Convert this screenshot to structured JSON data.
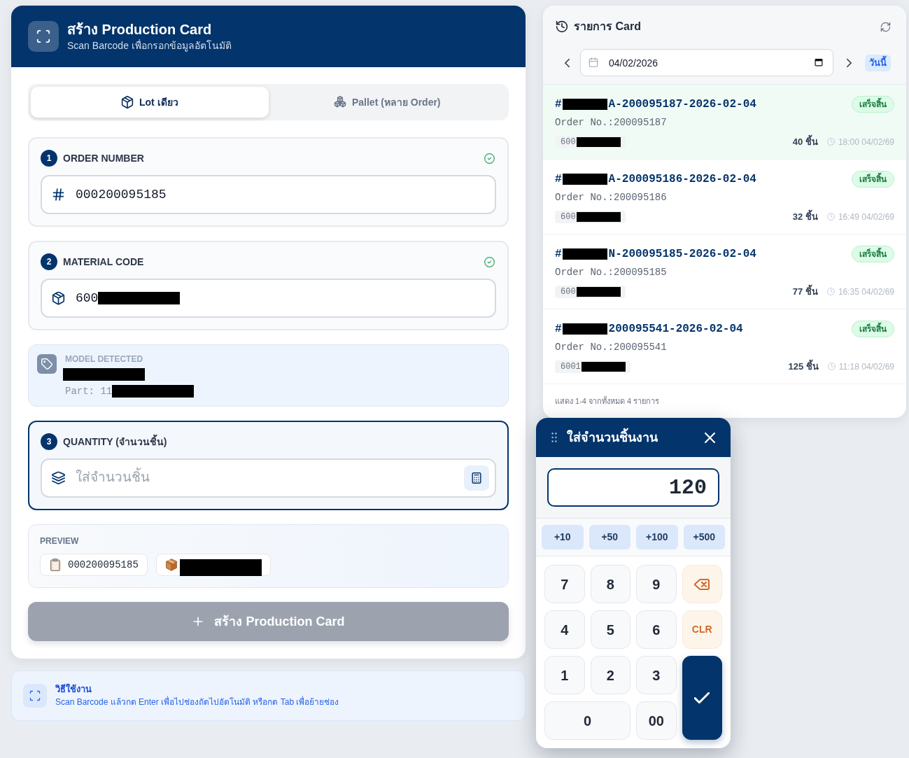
{
  "form_card": {
    "header": {
      "title": "สร้าง Production Card",
      "subtitle": "Scan Barcode เพื่อกรอกข้อมูลอัตโนมัติ"
    },
    "tabs": [
      {
        "kind": "lot",
        "label": "Lot เดียว",
        "selected": true
      },
      {
        "kind": "pallet",
        "label": "Pallet (หลาย Order)",
        "selected": false
      }
    ],
    "order_step": {
      "number": "1",
      "label": "ORDER NUMBER",
      "done": true,
      "active": false,
      "field": {
        "kind": "order",
        "value": "000200095185"
      }
    },
    "material_step": {
      "number": "2",
      "label": "MATERIAL CODE",
      "done": true,
      "active": false,
      "field": {
        "kind": "material",
        "value": "600",
        "redacted": true
      }
    },
    "model_detected": {
      "label": "MODEL DETECTED",
      "name_redacted": true,
      "part": "Part: 11",
      "part_redacted": true
    },
    "quantity_step": {
      "number": "3",
      "label": "QUANTITY (จำนวนชิ้น)",
      "done": false,
      "active": true,
      "field": {
        "kind": "quantity",
        "placeholder": "ใส่จำนวนชิ้น"
      }
    },
    "preview": {
      "label": "PREVIEW",
      "chips": [
        {
          "kind": "order",
          "value": "000200095185"
        },
        {
          "kind": "material",
          "redacted": true
        }
      ]
    },
    "submit_button": {
      "label": "สร้าง Production Card",
      "disabled": true
    }
  },
  "help": {
    "title": "วิธีใช้งาน",
    "text": "Scan Barcode แล้วกด Enter เพื่อไปช่องถัดไปอัตโนมัติ หรือกด Tab เพื่อย้ายช่อง"
  },
  "list_panel": {
    "title": "รายการ Card",
    "date": "04/02/2026",
    "today_button": "วันนี้",
    "items": [
      {
        "title_prefix": "#",
        "title_redacted": true,
        "title": "A-200095187-2026-02-04",
        "status": "เสร็จสิ้น",
        "order_no": "Order No.:200095187",
        "material": "600",
        "material_redacted": true,
        "quantity": "40 ชิ้น",
        "time": "18:00 04/02/69",
        "selected": true
      },
      {
        "title_prefix": "#",
        "title_redacted": true,
        "title": "A-200095186-2026-02-04",
        "status": "เสร็จสิ้น",
        "order_no": "Order No.:200095186",
        "material": "600",
        "material_redacted": true,
        "quantity": "32 ชิ้น",
        "time": "16:49 04/02/69",
        "selected": false
      },
      {
        "title_prefix": "#",
        "title_redacted": true,
        "title": "N-200095185-2026-02-04",
        "status": "เสร็จสิ้น",
        "order_no": "Order No.:200095185",
        "material": "600",
        "material_redacted": true,
        "quantity": "77 ชิ้น",
        "time": "16:35 04/02/69",
        "selected": false
      },
      {
        "title_prefix": "#",
        "title_redacted": true,
        "title": "200095541-2026-02-04",
        "status": "เสร็จสิ้น",
        "order_no": "Order No.:200095541",
        "material": "6001",
        "material_redacted": true,
        "quantity": "125 ชิ้น",
        "time": "11:18 04/02/69",
        "selected": false
      }
    ],
    "footer": "แสดง 1-4 จากทั้งหมด 4 รายการ"
  },
  "keypad": {
    "title": "ใส่จำนวนชิ้นงาน",
    "value": "120",
    "quick_add": [
      "+10",
      "+50",
      "+100",
      "+500"
    ],
    "keys": [
      {
        "kind": "digit",
        "label": "7"
      },
      {
        "kind": "digit",
        "label": "8"
      },
      {
        "kind": "digit",
        "label": "9"
      },
      {
        "kind": "backspace"
      },
      {
        "kind": "digit",
        "label": "4"
      },
      {
        "kind": "digit",
        "label": "5"
      },
      {
        "kind": "digit",
        "label": "6"
      },
      {
        "kind": "clear",
        "label": "CLR"
      },
      {
        "kind": "digit",
        "label": "1"
      },
      {
        "kind": "digit",
        "label": "2"
      },
      {
        "kind": "digit",
        "label": "3"
      },
      {
        "kind": "confirm"
      },
      {
        "kind": "wide",
        "label": "0"
      },
      {
        "kind": "digit",
        "label": "00"
      }
    ]
  }
}
